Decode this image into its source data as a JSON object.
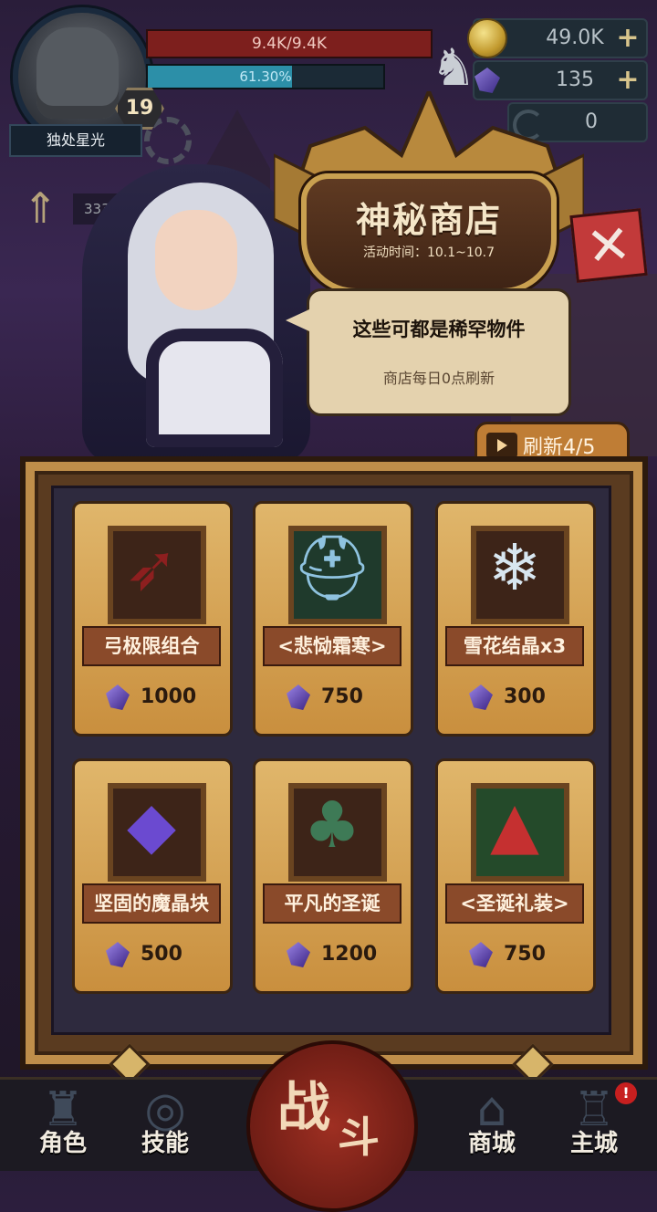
{
  "player": {
    "hp": "9.4K/9.4K",
    "xp_percent_text": "61.30%",
    "xp_fraction": 0.613,
    "level": "19",
    "name": "独处星光",
    "power": "333"
  },
  "currencies": {
    "gold": "49.0K",
    "gems": "135",
    "other": "0"
  },
  "shop": {
    "title": "神秘商店",
    "event_time": "活动时间：10.1~10.7",
    "speech_line1": "这些可都是稀罕物件",
    "speech_line2": "商店每日0点刷新",
    "refresh_label": "刷新4/5",
    "items": [
      {
        "name": "弓极限组合",
        "price": "1000",
        "icon": "bow-icon"
      },
      {
        "name": "<悲恸霜寒>",
        "price": "750",
        "icon": "frost-helmet-icon"
      },
      {
        "name": "雪花结晶x3",
        "price": "300",
        "icon": "snowflake-icon"
      },
      {
        "name": "坚固的魔晶块",
        "price": "500",
        "icon": "crystal-icon"
      },
      {
        "name": "平凡的圣诞",
        "price": "1200",
        "icon": "christmas-tree-icon"
      },
      {
        "name": "<圣诞礼装>",
        "price": "750",
        "icon": "santa-hat-icon"
      }
    ]
  },
  "nav": {
    "character": "角色",
    "skills": "技能",
    "battle_1": "战",
    "battle_2": "斗",
    "mall": "商城",
    "main_city": "主城",
    "badge": "!"
  }
}
